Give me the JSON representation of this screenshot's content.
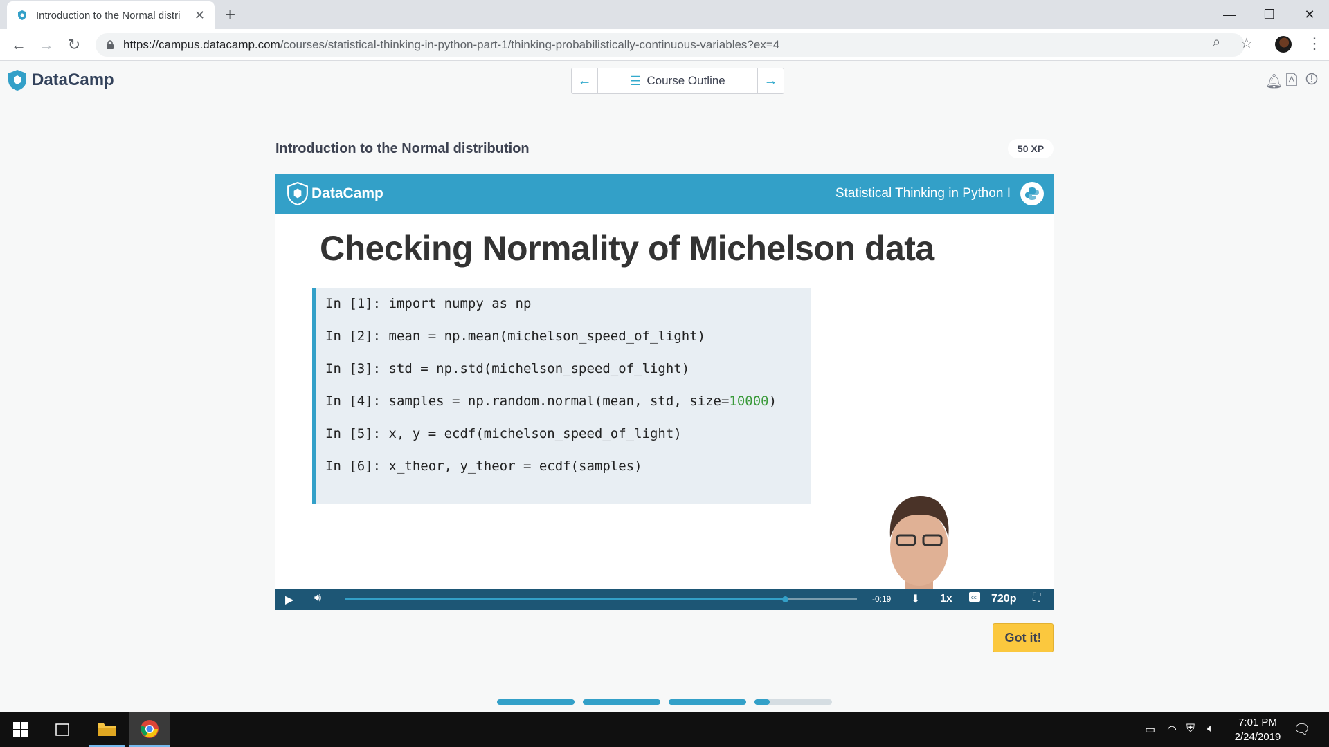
{
  "browser": {
    "tab_title": "Introduction to the Normal distri",
    "url_host": "https://campus.datacamp.com",
    "url_path": "/courses/statistical-thinking-in-python-part-1/thinking-probabilistically-continuous-variables?ex=4",
    "new_tab": "+",
    "close": "✕"
  },
  "header": {
    "brand": "DataCamp",
    "course_outline": "Course Outline"
  },
  "exercise": {
    "title": "Introduction to the Normal distribution",
    "xp": "50 XP"
  },
  "video": {
    "brand": "DataCamp",
    "course_name": "Statistical Thinking in Python I",
    "slide_title": "Checking Normality of Michelson data",
    "code": {
      "l1": "In [1]: import numpy as np",
      "l2": "In [2]: mean = np.mean(michelson_speed_of_light)",
      "l3": "In [3]: std = np.std(michelson_speed_of_light)",
      "l4_pre": "In [4]: samples = np.random.normal(mean, std, size=",
      "l4_num": "10000",
      "l4_post": ")",
      "l5": "In [5]: x, y = ecdf(michelson_speed_of_light)",
      "l6": "In [6]: x_theor, y_theor = ecdf(samples)"
    },
    "controls": {
      "time_remaining": "-0:19",
      "speed": "1x",
      "quality": "720p",
      "progress_fraction": 0.86
    }
  },
  "actions": {
    "got_it": "Got it!"
  },
  "lesson_progress": [
    1,
    1,
    1,
    0.2
  ],
  "taskbar": {
    "time": "7:01 PM",
    "date": "2/24/2019"
  },
  "colors": {
    "accent": "#33a0c8",
    "control_bar": "#1d5675",
    "cta": "#fbc83e"
  }
}
